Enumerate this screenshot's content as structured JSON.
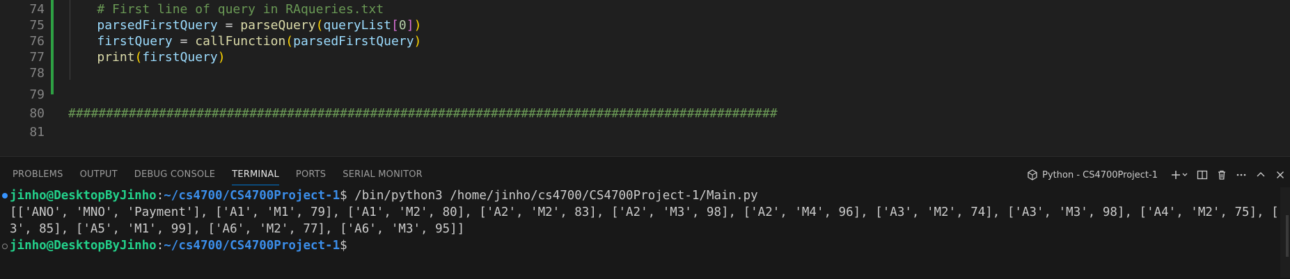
{
  "editor": {
    "lines": [
      {
        "num": "74",
        "text": "    # First line of query in RAqueries.txt"
      },
      {
        "num": "75",
        "text": "    parsedFirstQuery = parseQuery(queryList[0])"
      },
      {
        "num": "76",
        "text": "    firstQuery = callFunction(parsedFirstQuery)"
      },
      {
        "num": "77",
        "text": "    print(firstQuery)"
      },
      {
        "num": "78",
        "text": ""
      },
      {
        "num": "79",
        "text": ""
      },
      {
        "num": "80",
        "text": "##############################################################################################"
      },
      {
        "num": "81",
        "text": ""
      }
    ],
    "line75": {
      "a": "parsedFirstQuery",
      "eq": " = ",
      "fn": "parseQuery",
      "p1": "(",
      "arg": "queryList",
      "b1": "[",
      "idx": "0",
      "b2": "]",
      "p2": ")"
    },
    "line76": {
      "a": "firstQuery",
      "eq": " = ",
      "fn": "callFunction",
      "p1": "(",
      "arg": "parsedFirstQuery",
      "p2": ")"
    },
    "line77": {
      "fn": "print",
      "p1": "(",
      "arg": "firstQuery",
      "p2": ")"
    }
  },
  "panel": {
    "tabs": [
      "PROBLEMS",
      "OUTPUT",
      "DEBUG CONSOLE",
      "TERMINAL",
      "PORTS",
      "SERIAL MONITOR"
    ],
    "active_tab": "TERMINAL",
    "terminal_profile": "Python - CS4700Project-1",
    "icons": [
      "python-terminal-icon",
      "plus-icon",
      "chevron-down-icon",
      "split-icon",
      "trash-icon",
      "ellipsis-icon",
      "chevron-up-icon",
      "close-icon"
    ]
  },
  "terminal": {
    "prompt_user": "jinho@DesktopByJinho",
    "prompt_sep": ":",
    "prompt_path": "~/cs4700/CS4700Project-1",
    "prompt_end": "$",
    "command": " /bin/python3 /home/jinho/cs4700/CS4700Project-1/Main.py",
    "output_line1": "[['ANO', 'MNO', 'Payment'], ['A1', 'M1', 79], ['A1', 'M2', 80], ['A2', 'M2', 83], ['A2', 'M3', 98], ['A2', 'M4', 96], ['A3', 'M2', 74], ['A3', 'M3', 98], ['A4', 'M2', 75], ['A4', 'M",
    "output_line2": "3', 85], ['A5', 'M1', 99], ['A6', 'M2', 77], ['A6', 'M3', 95]]"
  },
  "colors": {
    "accent": "#0078d4",
    "prompt_user": "#23d18b",
    "prompt_path": "#3b8eea",
    "modified_bar": "#2ea043"
  }
}
